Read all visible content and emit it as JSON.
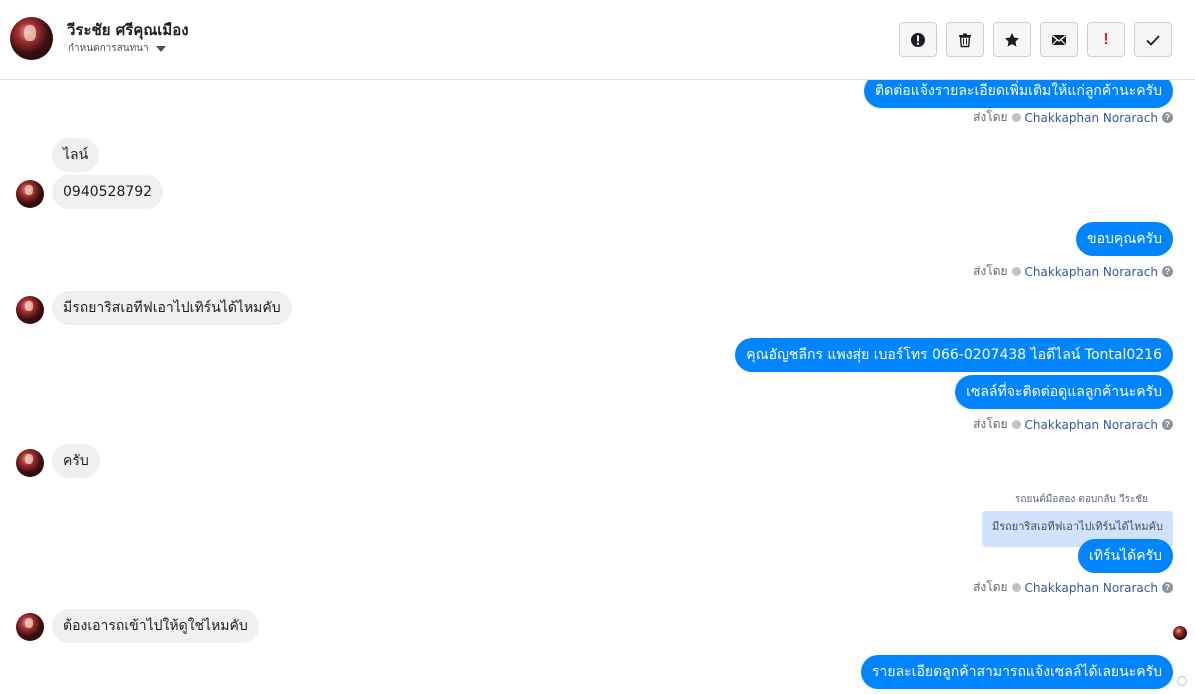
{
  "header": {
    "contact_name": "วีระชัย ศรีคุณเมือง",
    "subtitle": "กำหนดการสนทนา",
    "actions": [
      {
        "name": "report-button",
        "icon": "alert-circle-icon"
      },
      {
        "name": "delete-button",
        "icon": "trash-icon"
      },
      {
        "name": "star-button",
        "icon": "star-icon"
      },
      {
        "name": "mark-unread-button",
        "icon": "envelope-icon"
      },
      {
        "name": "spam-button",
        "icon": "exclamation-icon",
        "label": "!"
      },
      {
        "name": "done-button",
        "icon": "check-icon"
      }
    ]
  },
  "sent_by_label": "ส่งโดย",
  "agent_name": "Chakkaphan Norarach",
  "help_glyph": "?",
  "messages": {
    "m1": "ติดต่อแจ้งรายละเอียดเพิ่มเติมให้แก่ลูกค้านะครับ",
    "m2": "ไลน์",
    "m3": "0940528792",
    "m4": "ขอบคุณครับ",
    "m5": "มีรถยาริสเอทีฟเอาไปเทิร์นได้ไหมคับ",
    "m6": "คุณอัญชลีกร แพงสุ่ย       เบอร์โทร 066-0207438       ไอดีไลน์ Tontal0216",
    "m7": "เซลล์ที่จะติดต่อดูแลลูกค้านะครับ",
    "m8": "ครับ",
    "reply_note": "รถยนต์มือสอง ตอบกลับ วีระชัย",
    "quoted": "มีรถยาริสเอทีฟเอาไปเทิร์นได้ไหมคับ",
    "m9": "เทิร์นได้ครับ",
    "m10": "ต้องเอารถเข้าไปให้ดูใช่ไหมคับ",
    "m11": "รายละเอียดลูกค้าสามารถแจ้งเซลล์ได้เลยนะครับ"
  },
  "colors": {
    "outgoing_bubble": "#0084ff",
    "incoming_bubble": "#f1f0f0",
    "agent_link": "#385898",
    "spam_red": "#e02424"
  }
}
